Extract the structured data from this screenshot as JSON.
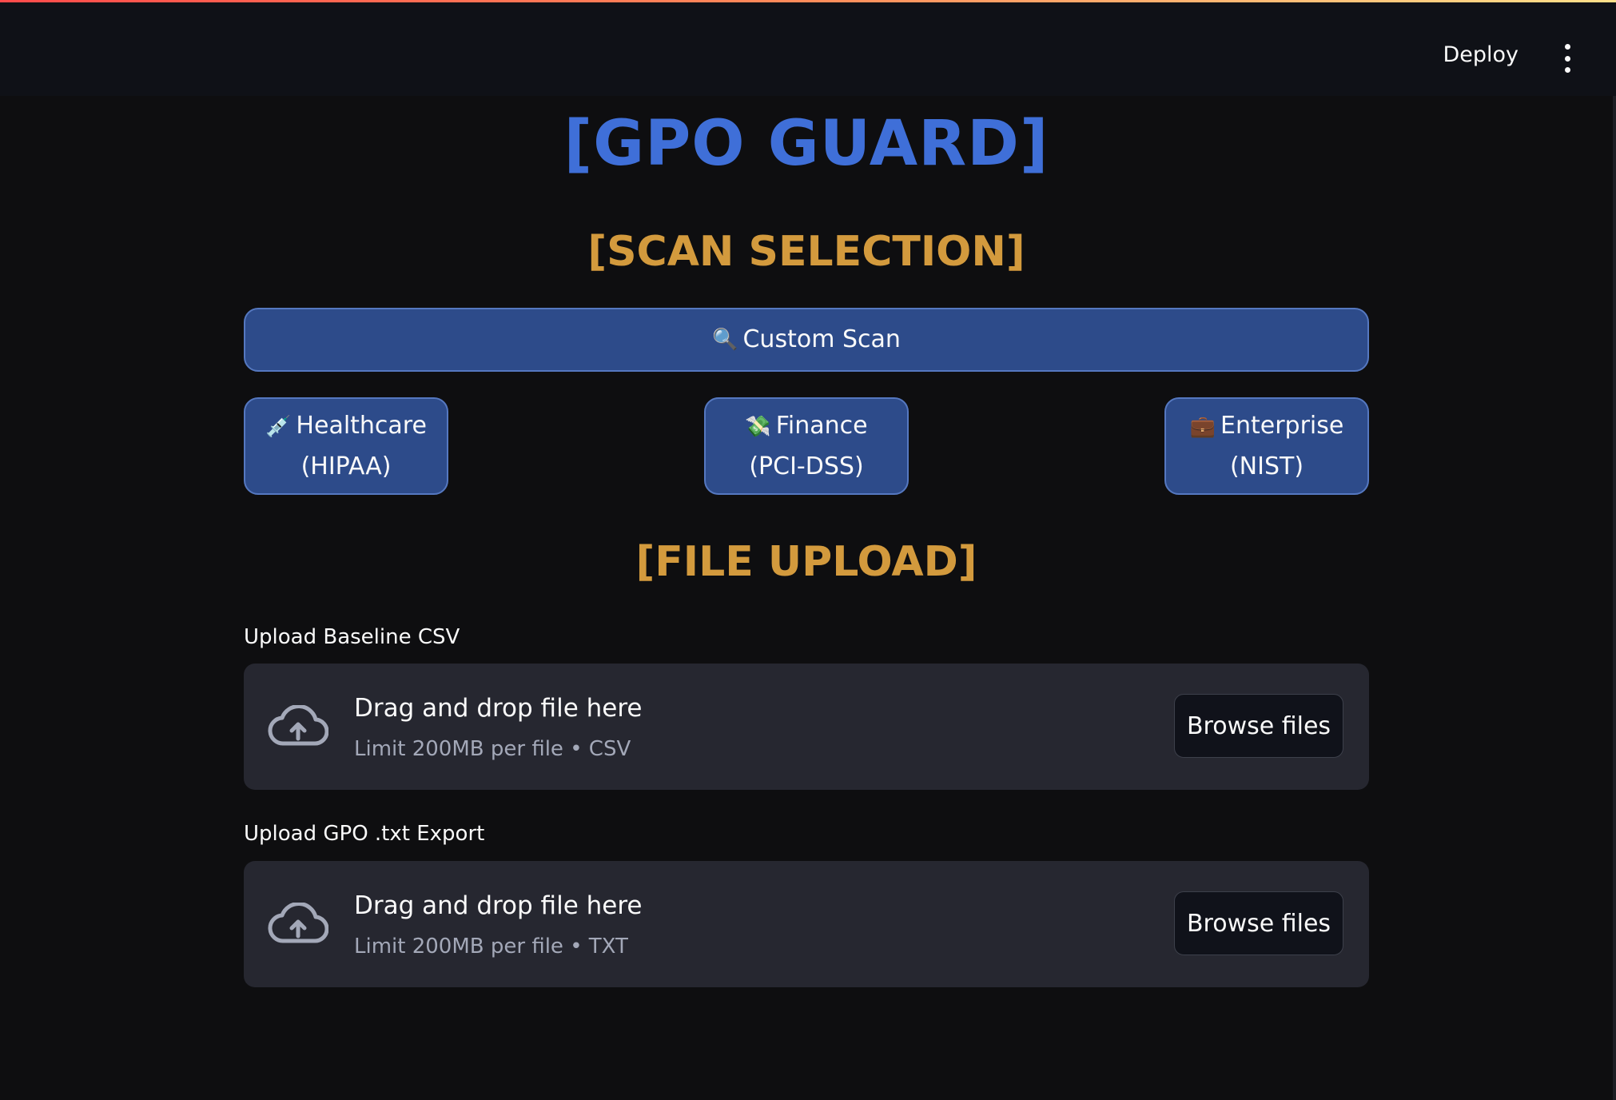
{
  "header": {
    "deploy_label": "Deploy",
    "menu_icon": "kebab-menu-icon"
  },
  "main": {
    "title": "[GPO GUARD]",
    "scan_section_title": "[SCAN SELECTION]",
    "custom_scan": {
      "icon": "🔍",
      "label": "Custom Scan"
    },
    "presets": [
      {
        "icon": "💉",
        "line1": "Healthcare",
        "line2": "(HIPAA)"
      },
      {
        "icon": "💸",
        "line1": "Finance",
        "line2": "(PCI-DSS)"
      },
      {
        "icon": "💼",
        "line1": "Enterprise",
        "line2": "(NIST)"
      }
    ],
    "upload_section_title": "[FILE UPLOAD]",
    "uploaders": [
      {
        "label": "Upload Baseline CSV",
        "drop_text": "Drag and drop file here",
        "limit_text": "Limit 200MB per file • CSV",
        "button_label": "Browse files",
        "icon": "cloud-upload-icon"
      },
      {
        "label": "Upload GPO .txt Export",
        "drop_text": "Drag and drop file here",
        "limit_text": "Limit 200MB per file • TXT",
        "button_label": "Browse files",
        "icon": "cloud-upload-icon"
      }
    ]
  },
  "colors": {
    "background": "#0e0e10",
    "header": "#0f1117",
    "title_blue": "#3f6fd8",
    "section_gold": "#d39a3d",
    "button_blue": "#2d4b8a",
    "dropzone": "#262730"
  }
}
